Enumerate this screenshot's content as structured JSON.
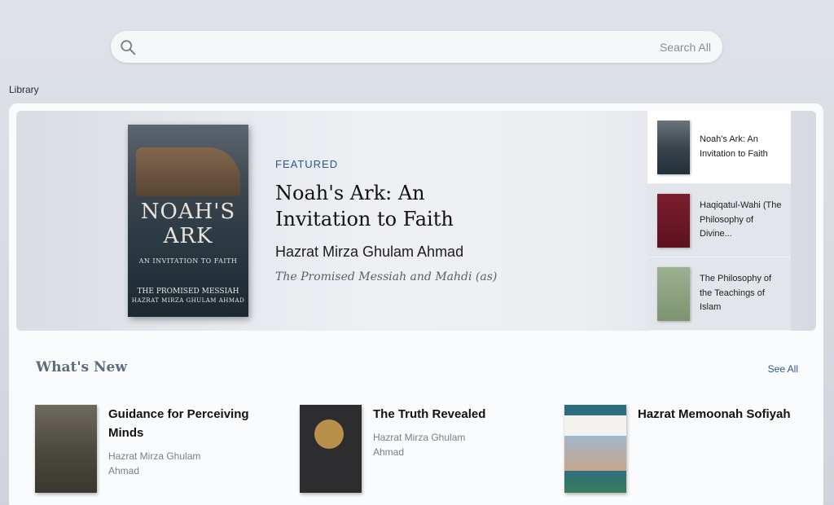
{
  "search": {
    "placeholder": "Search All",
    "icon": "search-icon"
  },
  "section_label": "Library",
  "featured": {
    "tag": "FEATURED",
    "title": "Noah's Ark: An Invitation to Faith",
    "author": "Hazrat Mirza Ghulam Ahmad",
    "author_title": "The Promised Messiah and Mahdi (as)",
    "cover": {
      "title": "NOAH'S\nARK",
      "subtitle": "AN INVITATION TO FAITH",
      "line1": "THE PROMISED MESSIAH",
      "line2": "HAZRAT MIRZA GHULAM AHMAD"
    }
  },
  "side_list": [
    {
      "label": "Noah's Ark: An Invitation to Faith",
      "active": true
    },
    {
      "label": "Haqiqatul-Wahi (The Philosophy of Divine...",
      "active": false
    },
    {
      "label": "The Philosophy of the Teachings of Islam",
      "active": false
    }
  ],
  "whats_new": {
    "title": "What's New",
    "see_all": "See All",
    "items": [
      {
        "title": "Guidance for Perceiving Minds",
        "author": "Hazrat Mirza Ghulam Ahmad"
      },
      {
        "title": "The Truth Revealed",
        "author": "Hazrat Mirza Ghulam Ahmad"
      },
      {
        "title": "Hazrat Memoonah Sofiyah",
        "author": ""
      }
    ]
  },
  "colors": {
    "accent": "#2f5592",
    "section_heading": "#5d6a7f"
  }
}
